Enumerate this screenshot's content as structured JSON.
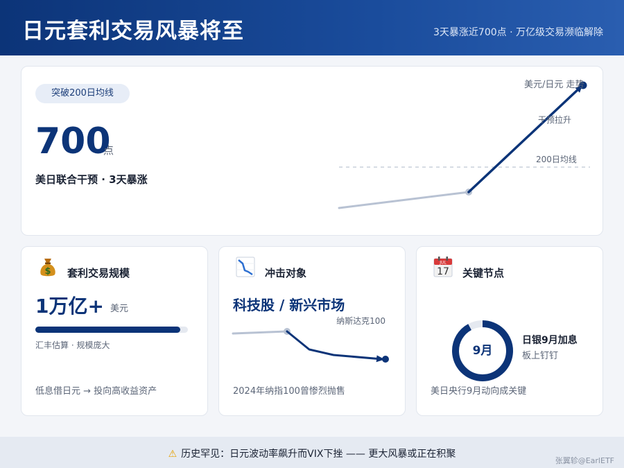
{
  "header": {
    "title": "日元套利交易风暴将至",
    "subtitle": "3天暴涨近700点 · 万亿级交易濒临解除"
  },
  "hero": {
    "badge": "突破200日均线",
    "number": "700",
    "unit": "点",
    "description": "美日联合干预 · 3天暴涨",
    "chart_title": "美元/日元 走势",
    "annotation_intervention": "干预拉升",
    "annotation_ma": "200日均线"
  },
  "cards": {
    "scale": {
      "icon": "money-bag-icon",
      "title": "套利交易规模",
      "value": "1万亿+",
      "unit": "美元",
      "progress": 0.95,
      "note": "汇丰估算 · 规模庞大",
      "footer": "低息借日元 → 投向高收益资产"
    },
    "impact": {
      "icon": "chart-decreasing-icon",
      "title": "冲击对象",
      "headline": "科技股 / 新兴市场",
      "series_label": "纳斯达克100",
      "footer": "2024年纳指100曾惨烈抛售"
    },
    "timeline": {
      "icon": "calendar-icon",
      "calendar_month": "JUL",
      "calendar_day": "17",
      "title": "关键节点",
      "ring_label": "9月",
      "ring_progress": 0.92,
      "event": "日银9月加息",
      "event_status": "板上钉钉",
      "footer": "美日央行9月动向成关键"
    }
  },
  "footer": {
    "warning_icon": "warning-icon",
    "text": "历史罕见：日元波动率飙升而VIX下挫 —— 更大风暴或正在积聚",
    "credit": "张翼轸@EarlETF"
  },
  "colors": {
    "primary": "#0c3478",
    "muted": "#b8c2d3",
    "text": "#1a2233",
    "warning": "#e6a100"
  }
}
